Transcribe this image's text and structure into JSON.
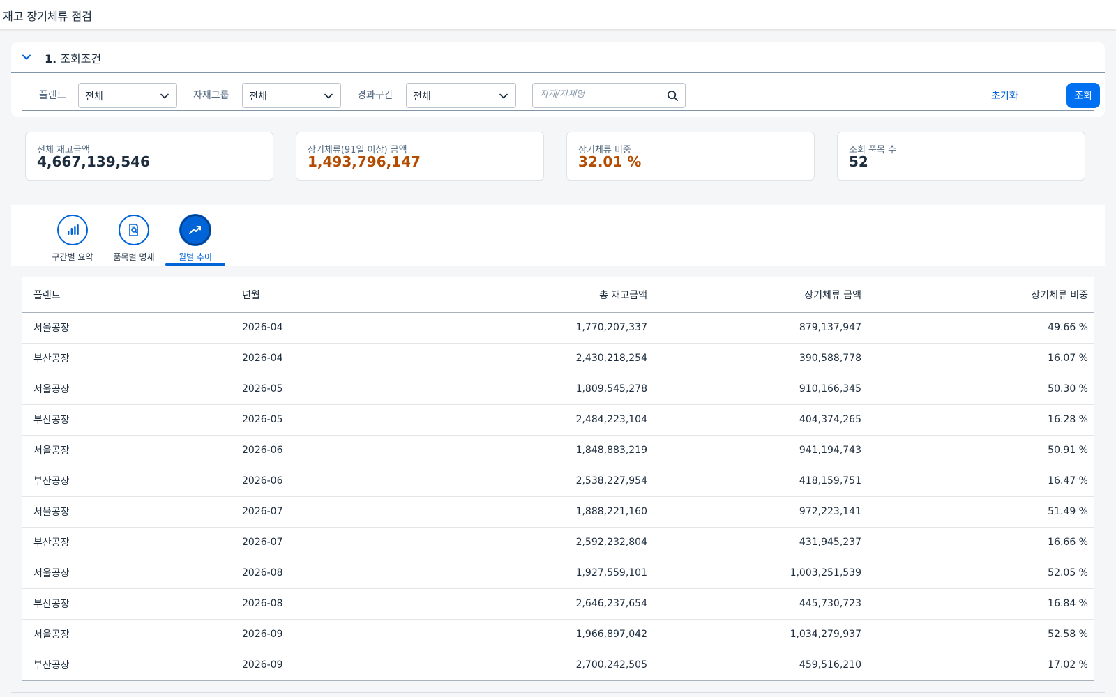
{
  "app": {
    "title": "재고 장기체류 점검"
  },
  "filter_panel": {
    "section_number": "1.",
    "section_title": "조회조건",
    "plant_label": "플랜트",
    "plant_value": "전체",
    "group_label": "자재그룹",
    "group_value": "전체",
    "period_label": "경과구간",
    "period_value": "전체",
    "search_placeholder": "자재/자재명",
    "reset_label": "초기화",
    "search_label": "조회"
  },
  "kpis": [
    {
      "label": "전체 재고금액",
      "value": "4,667,139,546"
    },
    {
      "label": "장기체류(91일 이상) 금액",
      "value": "1,493,796,147"
    },
    {
      "label": "장기체류 비중",
      "value": "32.01 %"
    },
    {
      "label": "조회 품목 수",
      "value": "52"
    }
  ],
  "tabs": [
    {
      "label": "구간별 요약",
      "icon": "bar-chart-icon"
    },
    {
      "label": "품목별 명세",
      "icon": "document-search-icon"
    },
    {
      "label": "월별 추이",
      "icon": "trend-up-icon",
      "active": true
    }
  ],
  "table": {
    "columns": [
      "플랜트",
      "년월",
      "총 재고금액",
      "장기체류 금액",
      "장기체류 비중"
    ],
    "rows": [
      [
        "서울공장",
        "2026-04",
        "1,770,207,337",
        "879,137,947",
        "49.66 %"
      ],
      [
        "부산공장",
        "2026-04",
        "2,430,218,254",
        "390,588,778",
        "16.07 %"
      ],
      [
        "서울공장",
        "2026-05",
        "1,809,545,278",
        "910,166,345",
        "50.30 %"
      ],
      [
        "부산공장",
        "2026-05",
        "2,484,223,104",
        "404,374,265",
        "16.28 %"
      ],
      [
        "서울공장",
        "2026-06",
        "1,848,883,219",
        "941,194,743",
        "50.91 %"
      ],
      [
        "부산공장",
        "2026-06",
        "2,538,227,954",
        "418,159,751",
        "16.47 %"
      ],
      [
        "서울공장",
        "2026-07",
        "1,888,221,160",
        "972,223,141",
        "51.49 %"
      ],
      [
        "부산공장",
        "2026-07",
        "2,592,232,804",
        "431,945,237",
        "16.66 %"
      ],
      [
        "서울공장",
        "2026-08",
        "1,927,559,101",
        "1,003,251,539",
        "52.05 %"
      ],
      [
        "부산공장",
        "2026-08",
        "2,646,237,654",
        "445,730,723",
        "16.84 %"
      ],
      [
        "서울공장",
        "2026-09",
        "1,966,897,042",
        "1,034,279,937",
        "52.58 %"
      ],
      [
        "부산공장",
        "2026-09",
        "2,700,242,505",
        "459,516,210",
        "17.02 %"
      ]
    ]
  },
  "colors": {
    "accent": "#0064d9",
    "button": "#0070f2",
    "warning": "#b34c00"
  }
}
